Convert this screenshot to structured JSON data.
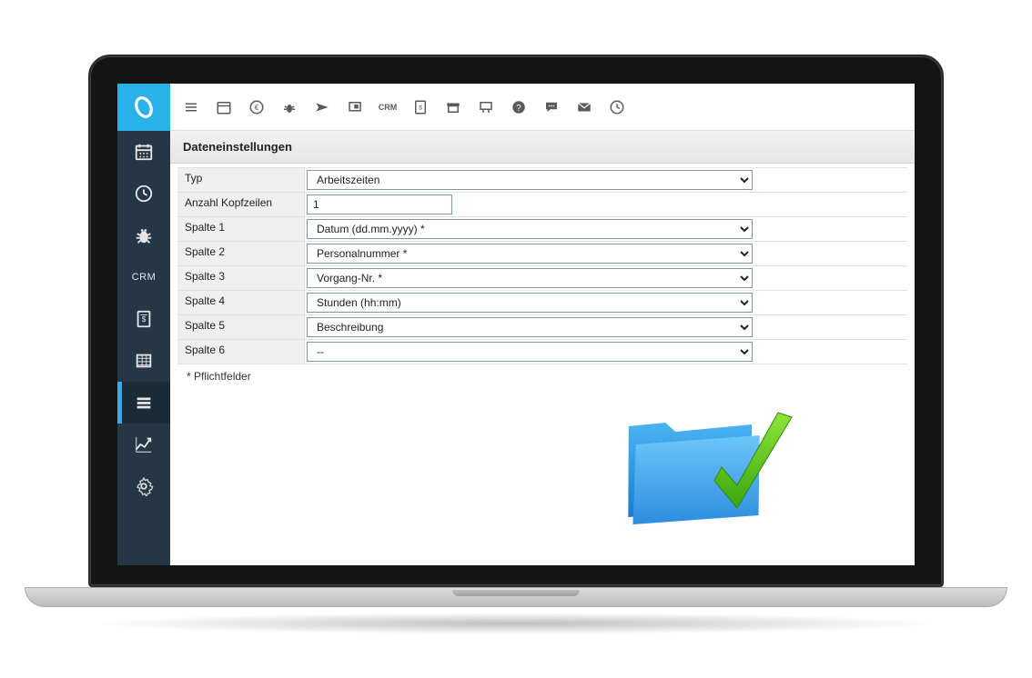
{
  "sidebar": {
    "crm_label": "CRM"
  },
  "toolbar": {
    "crm_label": "CRM"
  },
  "panel": {
    "title": "Dateneinstellungen",
    "required_note": "* Pflichtfelder",
    "rows": {
      "typ_label": "Typ",
      "typ_value": "Arbeitszeiten",
      "anzahl_label": "Anzahl Kopfzeilen",
      "anzahl_value": "1",
      "spalte1_label": "Spalte 1",
      "spalte1_value": "Datum (dd.mm.yyyy) *",
      "spalte2_label": "Spalte 2",
      "spalte2_value": "Personalnummer *",
      "spalte3_label": "Spalte 3",
      "spalte3_value": "Vorgang-Nr. *",
      "spalte4_label": "Spalte 4",
      "spalte4_value": "Stunden (hh:mm)",
      "spalte5_label": "Spalte 5",
      "spalte5_value": "Beschreibung",
      "spalte6_label": "Spalte 6",
      "spalte6_value": "--"
    }
  }
}
